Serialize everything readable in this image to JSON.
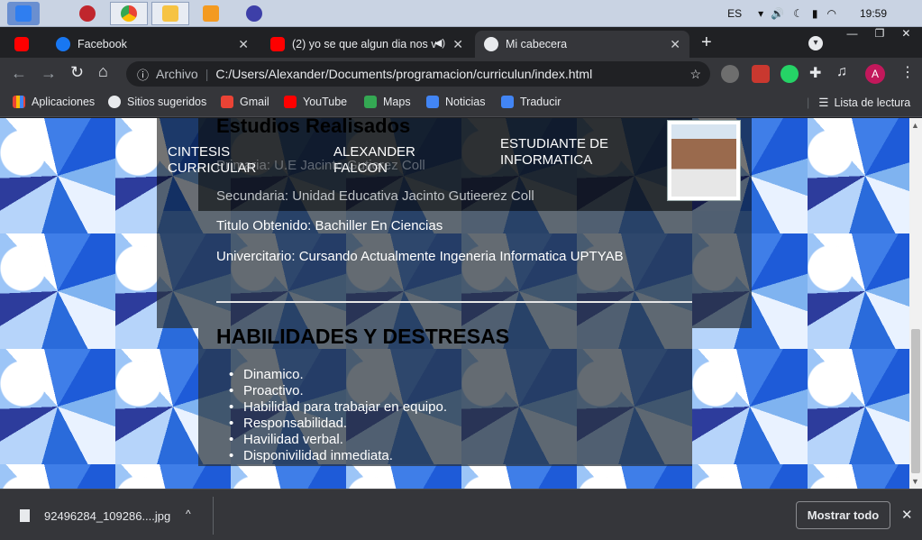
{
  "taskbar": {
    "language": "ES",
    "time": "19:59"
  },
  "tabs": [
    {
      "title": "",
      "icon": "youtube-icon"
    },
    {
      "title": "Facebook",
      "icon": "facebook-icon"
    },
    {
      "title": "(2) yo se que algun dia nos v",
      "icon": "youtube-icon"
    },
    {
      "title": "Mi cabecera",
      "icon": "globe-icon"
    }
  ],
  "omnibox": {
    "security_label": "Archivo",
    "url": "C:/Users/Alexander/Documents/programacion/curriculun/index.html"
  },
  "bookmarks": {
    "items": [
      "Aplicaciones",
      "Sitios sugeridos",
      "Gmail",
      "YouTube",
      "Maps",
      "Noticias",
      "Traducir"
    ],
    "reading_list": "Lista de lectura"
  },
  "page": {
    "header": {
      "col1": "CINTESIS CURRICULAR",
      "col2": "ALEXANDER FALCON",
      "col3": "ESTUDIANTE DE INFORMATICA"
    },
    "studies_heading": "Estudios Realisados",
    "studies": [
      "Primaria: U.E Jacinto Gutierez Coll",
      "Secundaria: Unidad Educativa Jacinto Gutieerez Coll",
      "Titulo Obtenido: Bachiller En Ciencias",
      "Univercitario: Cursando Actualmente Ingeneria Informatica UPTYAB"
    ],
    "skills_heading": "HABILIDADES Y DESTRESAS",
    "skills": [
      "Dinamico.",
      "Proactivo.",
      "Habilidad para trabajar en equipo.",
      "Responsabilidad.",
      "Havilidad verbal.",
      "Disponivilidad inmediata."
    ]
  },
  "downloads": {
    "file": "92496284_109286....jpg",
    "show_all": "Mostrar todo"
  }
}
